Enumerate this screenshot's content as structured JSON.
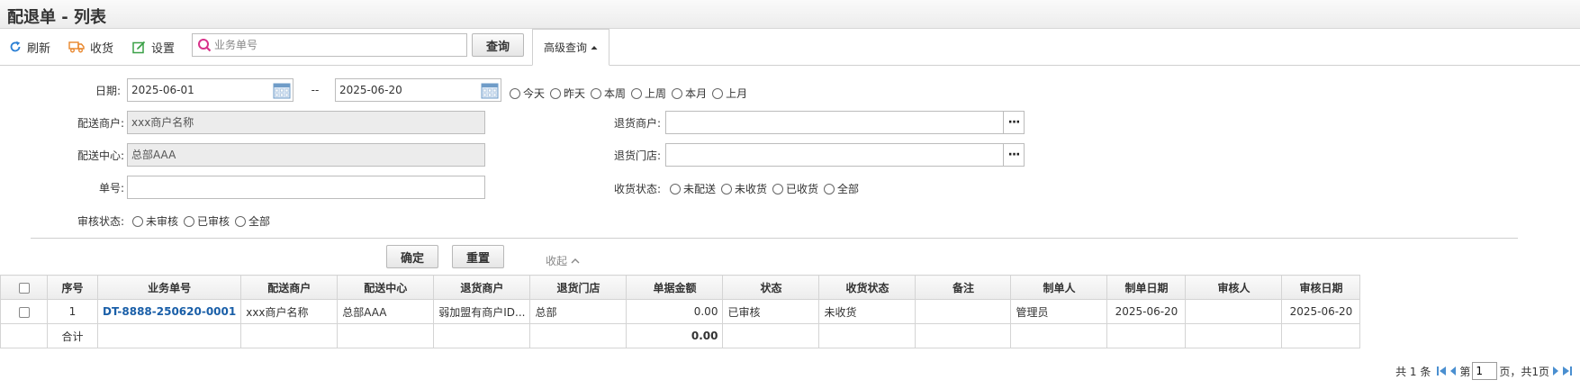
{
  "page": {
    "title": "配退单 - 列表"
  },
  "toolbar": {
    "refresh_label": "刷新",
    "receive_label": "收货",
    "settings_label": "设置",
    "search_placeholder": "业务单号",
    "search_value": "",
    "query_label": "查询",
    "advanced_label": "高级查询"
  },
  "filters": {
    "date_label": "日期:",
    "date_from": "2025-06-01",
    "date_sep": "--",
    "date_to": "2025-06-20",
    "date_quick": [
      "今天",
      "昨天",
      "本周",
      "上周",
      "本月",
      "上月"
    ],
    "merchant_label": "配送商户:",
    "merchant_value": "xxx商户名称",
    "center_label": "配送中心:",
    "center_value": "总部AAA",
    "bill_no_label": "单号:",
    "bill_no_value": "",
    "audit_label": "审核状态:",
    "audit_options": [
      "未审核",
      "已审核",
      "全部"
    ],
    "return_merchant_label": "退货商户:",
    "return_merchant_value": "",
    "return_store_label": "退货门店:",
    "return_store_value": "",
    "receive_status_label": "收货状态:",
    "receive_status_options": [
      "未配送",
      "未收货",
      "已收货",
      "全部"
    ],
    "confirm_label": "确定",
    "reset_label": "重置",
    "collapse_label": "收起"
  },
  "table": {
    "columns": [
      "序号",
      "业务单号",
      "配送商户",
      "配送中心",
      "退货商户",
      "退货门店",
      "单据金额",
      "状态",
      "收货状态",
      "备注",
      "制单人",
      "制单日期",
      "审核人",
      "审核日期"
    ],
    "rows": [
      {
        "seq": "1",
        "bill_no": "DT-8888-250620-0001",
        "merchant": "xxx商户名称",
        "center": "总部AAA",
        "return_merchant": "弱加盟有商户ID...",
        "return_store": "总部",
        "amount": "0.00",
        "status": "已审核",
        "receive_status": "未收货",
        "remark": "",
        "creator": "管理员",
        "create_date": "2025-06-20",
        "auditor": "",
        "audit_date": "2025-06-20"
      }
    ],
    "total_label": "合计",
    "total_amount": "0.00"
  },
  "pager": {
    "total_text": "共 1 条",
    "page_prefix": "第",
    "page_value": "1",
    "page_suffix": "页，共1页"
  },
  "colors": {
    "refresh_icon": "#2a7fd4",
    "receive_icon": "#e8852a",
    "settings_icon": "#3aa047",
    "search_icon": "#d8328a",
    "link": "#1a5fa8",
    "calendar_icon": "#6f9cc8",
    "pager_icon": "#4a8fd0"
  }
}
